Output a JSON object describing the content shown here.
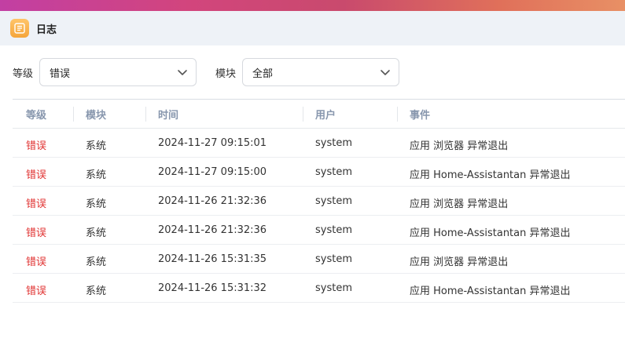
{
  "window": {
    "title": "日志"
  },
  "filters": {
    "level_label": "等级",
    "level_value": "错误",
    "module_label": "模块",
    "module_value": "全部"
  },
  "table": {
    "columns": [
      "等级",
      "模块",
      "时间",
      "用户",
      "事件"
    ],
    "rows": [
      {
        "level": "错误",
        "module": "系统",
        "time": "2024-11-27 09:15:01",
        "user": "system",
        "event": "应用 浏览器 异常退出"
      },
      {
        "level": "错误",
        "module": "系统",
        "time": "2024-11-27 09:15:00",
        "user": "system",
        "event": "应用 Home-Assistantan 异常退出"
      },
      {
        "level": "错误",
        "module": "系统",
        "time": "2024-11-26 21:32:36",
        "user": "system",
        "event": "应用 浏览器 异常退出"
      },
      {
        "level": "错误",
        "module": "系统",
        "time": "2024-11-26 21:32:36",
        "user": "system",
        "event": "应用 Home-Assistantan 异常退出"
      },
      {
        "level": "错误",
        "module": "系统",
        "time": "2024-11-26 15:31:35",
        "user": "system",
        "event": "应用 浏览器 异常退出"
      },
      {
        "level": "错误",
        "module": "系统",
        "time": "2024-11-26 15:31:32",
        "user": "system",
        "event": "应用 Home-Assistantan 异常退出"
      }
    ]
  },
  "colors": {
    "error": "#e0302f",
    "header_text": "#8796ad",
    "titlebar_bg": "#eef2f7",
    "app_icon": "#f5a53a"
  }
}
